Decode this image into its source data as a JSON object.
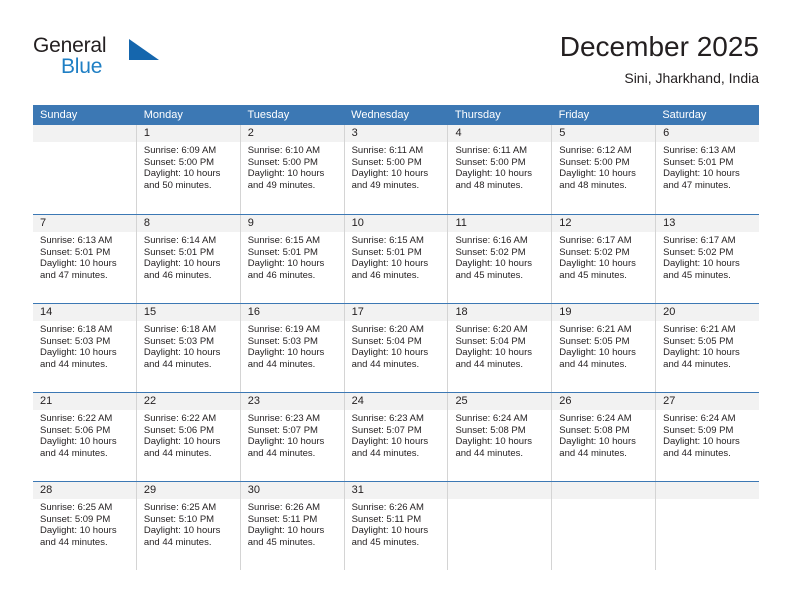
{
  "brand": {
    "name_top": "General",
    "name_bottom": "Blue",
    "logo_icon": "blue-triangle-icon",
    "accent_color": "#1f7fc4",
    "header_color": "#3c78b4"
  },
  "header": {
    "title": "December 2025",
    "subtitle": "Sini, Jharkhand, India"
  },
  "weekdays": [
    "Sunday",
    "Monday",
    "Tuesday",
    "Wednesday",
    "Thursday",
    "Friday",
    "Saturday"
  ],
  "labels": {
    "sunrise_prefix": "Sunrise:",
    "sunset_prefix": "Sunset:",
    "daylight_prefix": "Daylight:"
  },
  "weeks": [
    [
      {
        "day": "",
        "sunrise": "",
        "sunset": "",
        "daylight": ""
      },
      {
        "day": "1",
        "sunrise": "Sunrise: 6:09 AM",
        "sunset": "Sunset: 5:00 PM",
        "daylight": "Daylight: 10 hours and 50 minutes."
      },
      {
        "day": "2",
        "sunrise": "Sunrise: 6:10 AM",
        "sunset": "Sunset: 5:00 PM",
        "daylight": "Daylight: 10 hours and 49 minutes."
      },
      {
        "day": "3",
        "sunrise": "Sunrise: 6:11 AM",
        "sunset": "Sunset: 5:00 PM",
        "daylight": "Daylight: 10 hours and 49 minutes."
      },
      {
        "day": "4",
        "sunrise": "Sunrise: 6:11 AM",
        "sunset": "Sunset: 5:00 PM",
        "daylight": "Daylight: 10 hours and 48 minutes."
      },
      {
        "day": "5",
        "sunrise": "Sunrise: 6:12 AM",
        "sunset": "Sunset: 5:00 PM",
        "daylight": "Daylight: 10 hours and 48 minutes."
      },
      {
        "day": "6",
        "sunrise": "Sunrise: 6:13 AM",
        "sunset": "Sunset: 5:01 PM",
        "daylight": "Daylight: 10 hours and 47 minutes."
      }
    ],
    [
      {
        "day": "7",
        "sunrise": "Sunrise: 6:13 AM",
        "sunset": "Sunset: 5:01 PM",
        "daylight": "Daylight: 10 hours and 47 minutes."
      },
      {
        "day": "8",
        "sunrise": "Sunrise: 6:14 AM",
        "sunset": "Sunset: 5:01 PM",
        "daylight": "Daylight: 10 hours and 46 minutes."
      },
      {
        "day": "9",
        "sunrise": "Sunrise: 6:15 AM",
        "sunset": "Sunset: 5:01 PM",
        "daylight": "Daylight: 10 hours and 46 minutes."
      },
      {
        "day": "10",
        "sunrise": "Sunrise: 6:15 AM",
        "sunset": "Sunset: 5:01 PM",
        "daylight": "Daylight: 10 hours and 46 minutes."
      },
      {
        "day": "11",
        "sunrise": "Sunrise: 6:16 AM",
        "sunset": "Sunset: 5:02 PM",
        "daylight": "Daylight: 10 hours and 45 minutes."
      },
      {
        "day": "12",
        "sunrise": "Sunrise: 6:17 AM",
        "sunset": "Sunset: 5:02 PM",
        "daylight": "Daylight: 10 hours and 45 minutes."
      },
      {
        "day": "13",
        "sunrise": "Sunrise: 6:17 AM",
        "sunset": "Sunset: 5:02 PM",
        "daylight": "Daylight: 10 hours and 45 minutes."
      }
    ],
    [
      {
        "day": "14",
        "sunrise": "Sunrise: 6:18 AM",
        "sunset": "Sunset: 5:03 PM",
        "daylight": "Daylight: 10 hours and 44 minutes."
      },
      {
        "day": "15",
        "sunrise": "Sunrise: 6:18 AM",
        "sunset": "Sunset: 5:03 PM",
        "daylight": "Daylight: 10 hours and 44 minutes."
      },
      {
        "day": "16",
        "sunrise": "Sunrise: 6:19 AM",
        "sunset": "Sunset: 5:03 PM",
        "daylight": "Daylight: 10 hours and 44 minutes."
      },
      {
        "day": "17",
        "sunrise": "Sunrise: 6:20 AM",
        "sunset": "Sunset: 5:04 PM",
        "daylight": "Daylight: 10 hours and 44 minutes."
      },
      {
        "day": "18",
        "sunrise": "Sunrise: 6:20 AM",
        "sunset": "Sunset: 5:04 PM",
        "daylight": "Daylight: 10 hours and 44 minutes."
      },
      {
        "day": "19",
        "sunrise": "Sunrise: 6:21 AM",
        "sunset": "Sunset: 5:05 PM",
        "daylight": "Daylight: 10 hours and 44 minutes."
      },
      {
        "day": "20",
        "sunrise": "Sunrise: 6:21 AM",
        "sunset": "Sunset: 5:05 PM",
        "daylight": "Daylight: 10 hours and 44 minutes."
      }
    ],
    [
      {
        "day": "21",
        "sunrise": "Sunrise: 6:22 AM",
        "sunset": "Sunset: 5:06 PM",
        "daylight": "Daylight: 10 hours and 44 minutes."
      },
      {
        "day": "22",
        "sunrise": "Sunrise: 6:22 AM",
        "sunset": "Sunset: 5:06 PM",
        "daylight": "Daylight: 10 hours and 44 minutes."
      },
      {
        "day": "23",
        "sunrise": "Sunrise: 6:23 AM",
        "sunset": "Sunset: 5:07 PM",
        "daylight": "Daylight: 10 hours and 44 minutes."
      },
      {
        "day": "24",
        "sunrise": "Sunrise: 6:23 AM",
        "sunset": "Sunset: 5:07 PM",
        "daylight": "Daylight: 10 hours and 44 minutes."
      },
      {
        "day": "25",
        "sunrise": "Sunrise: 6:24 AM",
        "sunset": "Sunset: 5:08 PM",
        "daylight": "Daylight: 10 hours and 44 minutes."
      },
      {
        "day": "26",
        "sunrise": "Sunrise: 6:24 AM",
        "sunset": "Sunset: 5:08 PM",
        "daylight": "Daylight: 10 hours and 44 minutes."
      },
      {
        "day": "27",
        "sunrise": "Sunrise: 6:24 AM",
        "sunset": "Sunset: 5:09 PM",
        "daylight": "Daylight: 10 hours and 44 minutes."
      }
    ],
    [
      {
        "day": "28",
        "sunrise": "Sunrise: 6:25 AM",
        "sunset": "Sunset: 5:09 PM",
        "daylight": "Daylight: 10 hours and 44 minutes."
      },
      {
        "day": "29",
        "sunrise": "Sunrise: 6:25 AM",
        "sunset": "Sunset: 5:10 PM",
        "daylight": "Daylight: 10 hours and 44 minutes."
      },
      {
        "day": "30",
        "sunrise": "Sunrise: 6:26 AM",
        "sunset": "Sunset: 5:11 PM",
        "daylight": "Daylight: 10 hours and 45 minutes."
      },
      {
        "day": "31",
        "sunrise": "Sunrise: 6:26 AM",
        "sunset": "Sunset: 5:11 PM",
        "daylight": "Daylight: 10 hours and 45 minutes."
      },
      {
        "day": "",
        "sunrise": "",
        "sunset": "",
        "daylight": ""
      },
      {
        "day": "",
        "sunrise": "",
        "sunset": "",
        "daylight": ""
      },
      {
        "day": "",
        "sunrise": "",
        "sunset": "",
        "daylight": ""
      }
    ]
  ]
}
